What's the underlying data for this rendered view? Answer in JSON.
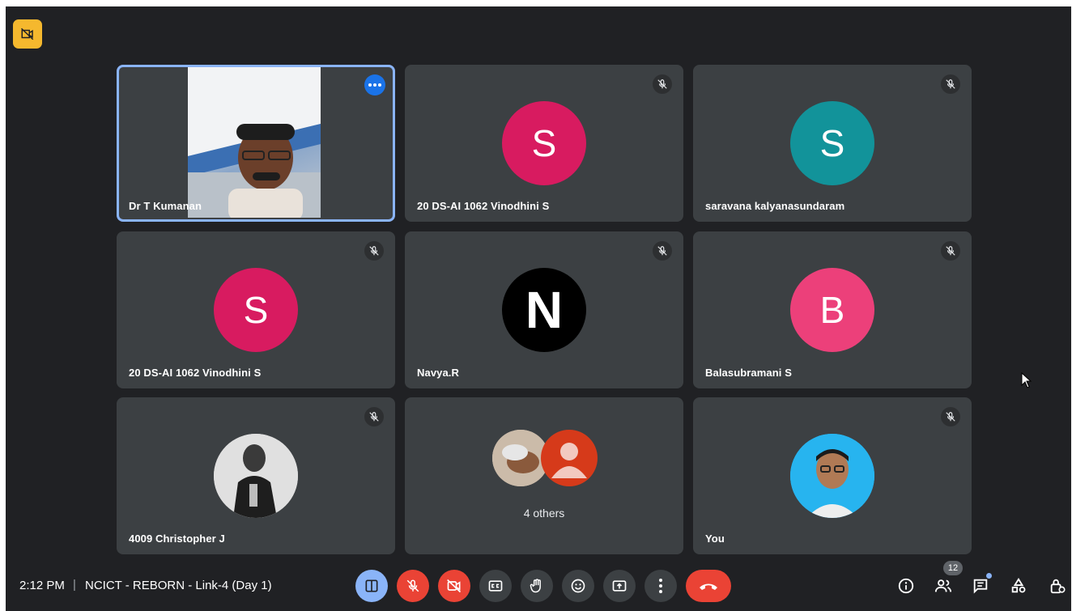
{
  "meeting": {
    "time": "2:12 PM",
    "separator": "|",
    "title": "NCICT - REBORN - Link-4 (Day 1)"
  },
  "tiles": [
    {
      "name": "Dr T Kumanan",
      "kind": "video",
      "active": true
    },
    {
      "name": "20 DS-AI 1062 Vinodhini S",
      "initial": "S",
      "avatar_color": "#d81b60"
    },
    {
      "name": "saravana kalyanasundaram",
      "initial": "S",
      "avatar_color": "#12939a"
    },
    {
      "name": "20 DS-AI 1062 Vinodhini S",
      "initial": "S",
      "avatar_color": "#d81b60"
    },
    {
      "name": "Navya.R",
      "initial": "N",
      "avatar_color": "#000000"
    },
    {
      "name": "Balasubramani S",
      "initial": "B",
      "avatar_color": "#ec407a"
    },
    {
      "name": "4009 Christopher J",
      "kind": "photo"
    },
    {
      "others_label": "4 others",
      "kind": "group"
    },
    {
      "name": "You",
      "kind": "photo"
    }
  ],
  "people_count": "12",
  "colors": {
    "background": "#202124",
    "tile": "#3c4043",
    "end_call": "#ea4335",
    "accent_blue": "#8ab4f8",
    "badge_yellow": "#f5b82e"
  },
  "icons": {
    "controls": [
      "layout-icon",
      "mic-off-icon",
      "camera-off-icon",
      "captions-icon",
      "raise-hand-icon",
      "emoji-icon",
      "present-icon",
      "more-options-icon",
      "end-call-icon"
    ],
    "right": [
      "info-icon",
      "people-icon",
      "chat-icon",
      "activities-icon",
      "host-controls-icon"
    ]
  }
}
